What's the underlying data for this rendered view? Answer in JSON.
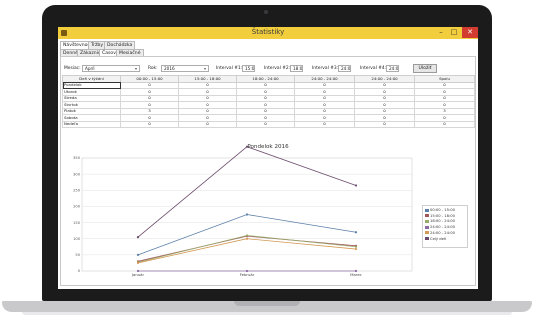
{
  "window": {
    "title": "Štatistiky",
    "min_label": "–",
    "max_label": "□",
    "close_label": "✕"
  },
  "main_tabs": [
    "Návštevnosť",
    "Tržby",
    "Dochádzka"
  ],
  "sub_tabs": [
    "Denné",
    "Zákazníci",
    "Časové",
    "Mesiačné"
  ],
  "filters": {
    "month_label": "Mesiac:",
    "month_value": "Apríl",
    "year_label": "Rok:",
    "year_value": "2016",
    "intervals": [
      {
        "label": "Interval #1:",
        "value": "15:00"
      },
      {
        "label": "Interval #2:",
        "value": "18:00"
      },
      {
        "label": "Interval #3:",
        "value": "24:00"
      },
      {
        "label": "Interval #4:",
        "value": "24:00"
      }
    ],
    "save_button": "Uložiť"
  },
  "table": {
    "headers": [
      "Deň v týždni",
      "00:00 - 15:00",
      "15:00 - 18:00",
      "18:00 - 24:00",
      "24:00 - 24:00",
      "24:00 - 24:00",
      "Spolu"
    ],
    "rows": [
      [
        "Pondelok",
        "0",
        "0",
        "0",
        "0",
        "0",
        "0"
      ],
      [
        "Utorok",
        "0",
        "0",
        "0",
        "0",
        "0",
        "0"
      ],
      [
        "Streda",
        "0",
        "0",
        "0",
        "0",
        "0",
        "0"
      ],
      [
        "Štvrtok",
        "0",
        "0",
        "0",
        "0",
        "0",
        "0"
      ],
      [
        "Piatok",
        "3",
        "0",
        "0",
        "0",
        "0",
        "3"
      ],
      [
        "Sobota",
        "0",
        "0",
        "0",
        "0",
        "0",
        "0"
      ],
      [
        "Nedeľa",
        "0",
        "0",
        "0",
        "0",
        "0",
        "0"
      ]
    ]
  },
  "chart_data": {
    "type": "line",
    "title": "Pondelok 2016",
    "categories": [
      "Január",
      "Február",
      "Marec"
    ],
    "ylim": [
      0,
      350
    ],
    "yticks": [
      "0",
      "50",
      "100",
      "150",
      "200",
      "250",
      "300",
      "350"
    ],
    "grid": true,
    "legend_position": "right",
    "series": [
      {
        "name": "00:00 - 15:00",
        "color": "#5b7fa8",
        "values": [
          50,
          175,
          120
        ]
      },
      {
        "name": "15:00 - 18:00",
        "color": "#a0565a",
        "values": [
          30,
          108,
          78
        ]
      },
      {
        "name": "18:00 - 24:00",
        "color": "#9aa86a",
        "values": [
          27,
          110,
          75
        ]
      },
      {
        "name": "24:00 - 24:00",
        "color": "#8a6aa0",
        "values": [
          0,
          0,
          0
        ]
      },
      {
        "name": "24:00 - 24:00",
        "color": "#d49a55",
        "values": [
          25,
          100,
          68
        ]
      },
      {
        "name": "Celý deň",
        "color": "#6a4a6a",
        "values": [
          105,
          385,
          265
        ]
      }
    ]
  }
}
